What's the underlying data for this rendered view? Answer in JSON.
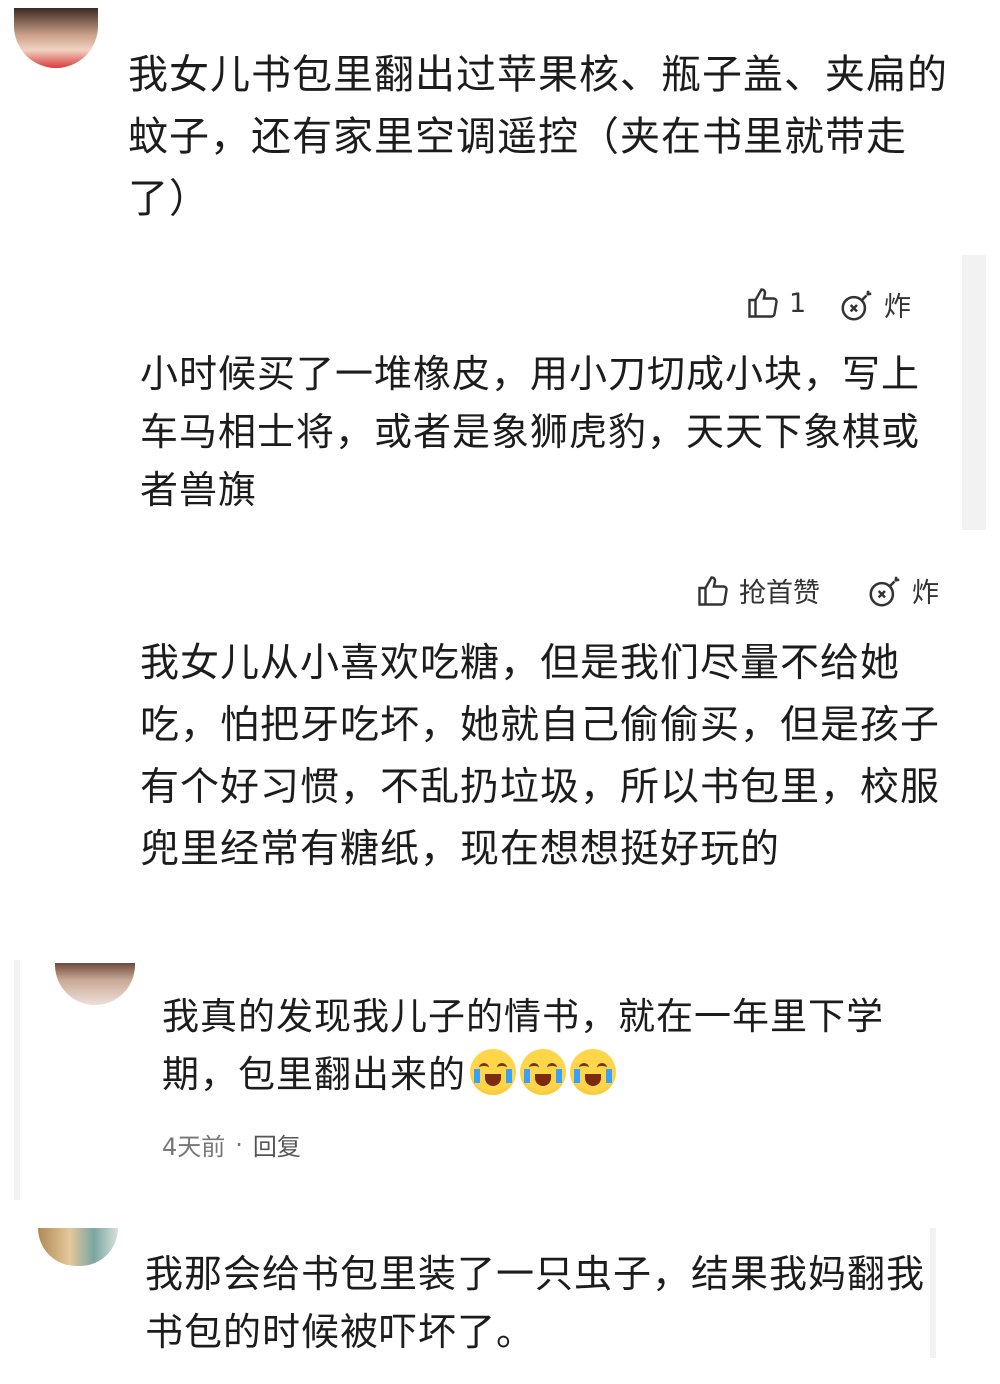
{
  "comments": [
    {
      "text": "我女儿书包里翻出过苹果核、瓶子盖、夹扁的蚊子，还有家里空调遥控（夹在书里就带走了）"
    },
    {
      "likes": "1",
      "bomb_label": "炸",
      "text": "小时候买了一堆橡皮，用小刀切成小块，写上车马相士将，或者是象狮虎豹，天天下象棋或者兽旗"
    },
    {
      "like_label": "抢首赞",
      "bomb_label": "炸",
      "text": "我女儿从小喜欢吃糖，但是我们尽量不给她吃，怕把牙吃坏，她就自己偷偷买，但是孩子有个好习惯，不乱扔垃圾，所以书包里，校服兜里经常有糖纸，现在想想挺好玩的"
    },
    {
      "text": "我真的发现我儿子的情书，就在一年里下学期，包里翻出来的",
      "emojis": [
        "crying-face",
        "crying-face",
        "crying-face"
      ],
      "time": "4天前",
      "separator": "·",
      "reply_label": "回复"
    },
    {
      "text": "我那会给书包里装了一只虫子，结果我妈翻我书包的时候被吓坏了。"
    }
  ]
}
